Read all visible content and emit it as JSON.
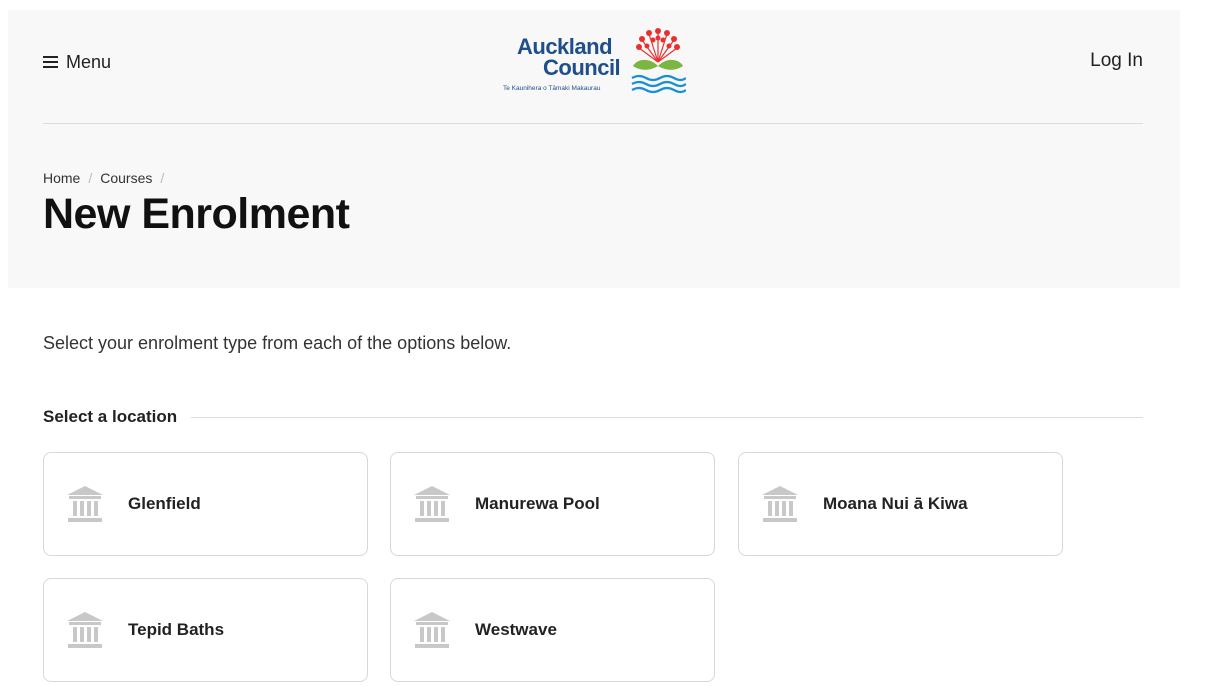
{
  "header": {
    "menu_label": "Menu",
    "login_label": "Log In",
    "logo": {
      "line1": "Auckland",
      "line2": "Council",
      "tagline": "Te Kaunihera o Tāmaki Makaurau",
      "brand_color": "#1f4e8c",
      "flower_color": "#e8312f",
      "leaf_color": "#7bb642",
      "water_color": "#1a8fd1"
    }
  },
  "breadcrumb": {
    "items": [
      "Home",
      "Courses"
    ],
    "separator": "/"
  },
  "page_title": "New Enrolment",
  "intro_text": "Select your enrolment type from each of the options below.",
  "location_section": {
    "heading": "Select a location",
    "locations": [
      {
        "name": "Glenfield",
        "icon": "building-icon"
      },
      {
        "name": "Manurewa Pool",
        "icon": "building-icon"
      },
      {
        "name": "Moana Nui ā Kiwa",
        "icon": "building-icon"
      },
      {
        "name": "Tepid Baths",
        "icon": "building-icon"
      },
      {
        "name": "Westwave",
        "icon": "building-icon"
      }
    ]
  }
}
